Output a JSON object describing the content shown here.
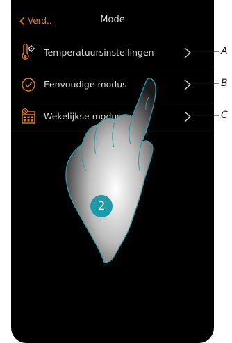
{
  "header": {
    "back_label": "Verd...",
    "title": "Mode"
  },
  "menu": {
    "items": [
      {
        "label": "Temperatuursinstellingen",
        "icon": "thermometer-gear-icon",
        "callout": "A"
      },
      {
        "label": "Eenvoudige modus",
        "icon": "check-circle-icon",
        "callout": "B"
      },
      {
        "label": "Wekelijkse modus",
        "icon": "weekly-calendar-icon",
        "callout": "C"
      }
    ]
  },
  "overlay": {
    "step_number": "2",
    "gesture": "tap-hand-icon"
  },
  "colors": {
    "accent": "#e87a20",
    "background": "#000000",
    "text": "#d8d8d8",
    "step_badge": "#1e9aa8"
  }
}
